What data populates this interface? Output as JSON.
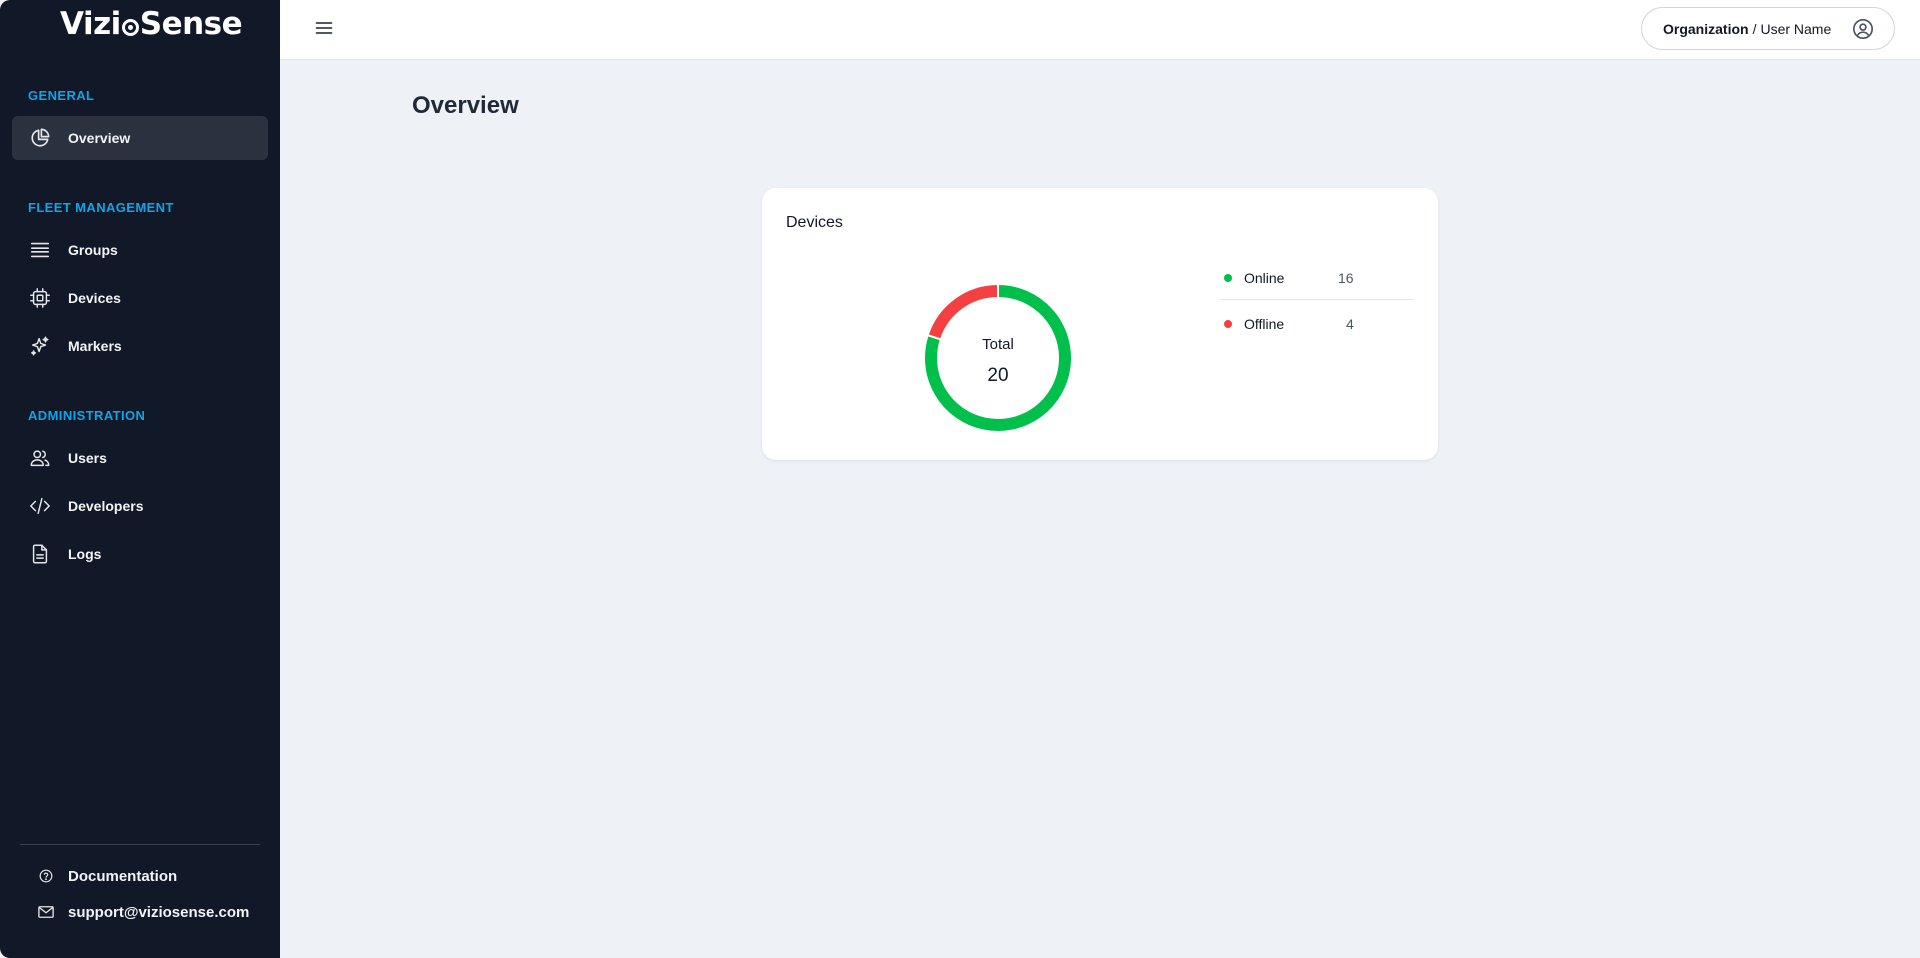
{
  "brand": {
    "logo_text_left": "Vizi",
    "logo_text_right": "Sense"
  },
  "sidebar": {
    "sections": [
      {
        "title": "GENERAL"
      },
      {
        "title": "FLEET MANAGEMENT"
      },
      {
        "title": "ADMINISTRATION"
      }
    ],
    "items": [
      {
        "label": "Overview",
        "icon": "pie-chart-icon",
        "active": true
      },
      {
        "label": "Groups",
        "icon": "list-icon"
      },
      {
        "label": "Devices",
        "icon": "chip-icon"
      },
      {
        "label": "Markers",
        "icon": "sparkles-icon"
      },
      {
        "label": "Users",
        "icon": "users-icon"
      },
      {
        "label": "Developers",
        "icon": "code-icon"
      },
      {
        "label": "Logs",
        "icon": "document-icon"
      }
    ],
    "footer": {
      "documentation": "Documentation",
      "support_email": "support@viziosense.com"
    }
  },
  "header": {
    "organization": "Organization",
    "separator": "/",
    "user_name": "User Name"
  },
  "main": {
    "page_title": "Overview",
    "devices_card": {
      "title": "Devices",
      "total_label": "Total",
      "total_value": "20",
      "legend": [
        {
          "name": "Online",
          "value": "16",
          "color": "#00c04b"
        },
        {
          "name": "Offline",
          "value": "4",
          "color": "#f44040"
        }
      ]
    }
  },
  "chart_data": {
    "type": "pie",
    "categories": [
      "Online",
      "Offline"
    ],
    "values": [
      16,
      4
    ],
    "colors": [
      "#00c04b",
      "#f44040"
    ],
    "title": "Devices"
  },
  "colors": {
    "sidebar_bg": "#111827",
    "section_title": "#0ea5e9",
    "page_bg": "#eef2f6"
  }
}
